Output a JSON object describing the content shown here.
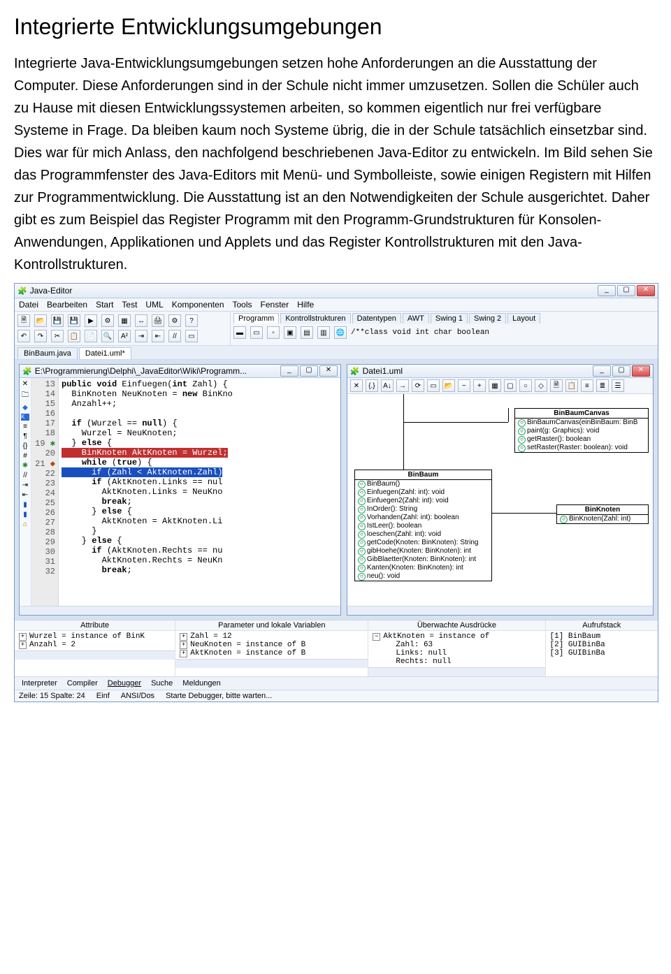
{
  "article": {
    "title": "Integrierte Entwicklungsumgebungen",
    "paragraph": "Integrierte Java-Entwicklungsumgebungen setzen hohe Anforderungen an die Ausstattung der Computer. Diese Anforderungen sind in der Schule nicht immer umzusetzen. Sollen die Schüler auch zu Hause mit diesen Entwicklungssystemen arbeiten, so kommen eigentlich nur frei verfügbare Systeme in Frage. Da bleiben kaum noch Systeme übrig, die in der Schule tatsächlich einsetzbar sind. Dies war für mich Anlass, den nachfolgend beschriebenen Java-Editor zu entwickeln. Im Bild sehen Sie das Programmfenster des Java-Editors mit Menü- und Symbolleiste, sowie einigen Registern mit Hilfen zur Programmentwicklung. Die Ausstattung ist an den Notwendigkeiten der Schule ausgerichtet. Daher gibt es zum Beispiel das Register Programm mit den Programm-Grundstrukturen für Konsolen-Anwendungen, Applikationen und Applets und das Register Kontrollstrukturen mit den Java-Kontrollstrukturen."
  },
  "ide": {
    "app_title": "Java-Editor",
    "menus": [
      "Datei",
      "Bearbeiten",
      "Start",
      "Test",
      "UML",
      "Komponenten",
      "Tools",
      "Fenster",
      "Hilfe"
    ],
    "category_tabs": [
      "Programm",
      "Kontrollstrukturen",
      "Datentypen",
      "AWT",
      "Swing 1",
      "Swing 2",
      "Layout"
    ],
    "template_hint": "/**class void int char boolean",
    "file_tabs": [
      "BinBaum.java",
      "Datei1.uml*"
    ],
    "file_tabs_active": 1,
    "code_window": {
      "title": "E:\\Programmierung\\Delphi\\_JavaEditor\\Wiki\\Programm...",
      "first_line": 13,
      "lines": [
        "public void Einfuegen(int Zahl) {",
        "  BinKnoten NeuKnoten = new BinKno",
        "  Anzahl++;",
        "",
        "  if (Wurzel == null) {",
        "    Wurzel = NeuKnoten;",
        "  } else {",
        "    BinKnoten AktKnoten = Wurzel;",
        "    while (true) {",
        "      if (Zahl < AktKnoten.Zahl)",
        "      if (AktKnoten.Links == nul",
        "        AktKnoten.Links = NeuKno",
        "        break;",
        "      } else {",
        "        AktKnoten = AktKnoten.Li",
        "      }",
        "    } else {",
        "      if (AktKnoten.Rechts == nu",
        "        AktKnoten.Rechts = NeuKn",
        "        break;"
      ],
      "highlight_red_index": 7,
      "highlight_blue_index": 9,
      "breakpoint_index": 7,
      "current_index": 9
    },
    "uml_window": {
      "title": "Datei1.uml",
      "classes": {
        "canvas": {
          "name": "BinBaumCanvas",
          "members": [
            "BinBaumCanvas(einBinBaum: BinB",
            "paint(g: Graphics): void",
            "getRaster(): boolean",
            "setRaster(Raster: boolean): void"
          ]
        },
        "baum": {
          "name": "BinBaum",
          "members": [
            "BinBaum()",
            "Einfuegen(Zahl: int): void",
            "Einfuegen2(Zahl: int): void",
            "InOrder(): String",
            "Vorhanden(Zahl: int): boolean",
            "IstLeer(): boolean",
            "loeschen(Zahl: int): void",
            "getCode(Knoten: BinKnoten): String",
            "gibHoehe(Knoten: BinKnoten): int",
            "GibBlaetter(Knoten: BinKnoten): int",
            "Kanten(Knoten: BinKnoten): int",
            "neu(): void"
          ]
        },
        "knoten": {
          "name": "BinKnoten",
          "members": [
            "BinKnoten(Zahl: int)"
          ]
        }
      }
    },
    "panels": {
      "attribute": {
        "header": "Attribute",
        "rows": [
          "Wurzel = instance of BinK",
          "Anzahl = 2"
        ]
      },
      "params": {
        "header": "Parameter und lokale Variablen",
        "rows": [
          "Zahl = 12",
          "NeuKnoten = instance of B",
          "AktKnoten = instance of B"
        ]
      },
      "watch": {
        "header": "Überwachte Ausdrücke",
        "rows": [
          "AktKnoten = instance of",
          "  Zahl: 63",
          "  Links: null",
          "  Rechts: null"
        ]
      },
      "stack": {
        "header": "Aufrufstack",
        "rows": [
          "[1] BinBaum",
          "[2] GUIBinBa",
          "[3] GUIBinBa"
        ]
      }
    },
    "bottom_tabs": [
      "Interpreter",
      "Compiler",
      "Debugger",
      "Suche",
      "Meldungen"
    ],
    "bottom_tabs_active": 2,
    "status": {
      "pos": "Zeile: 15 Spalte: 24",
      "mode": "Einf",
      "encoding": "ANSI/Dos",
      "msg": "Starte Debugger, bitte warten..."
    }
  }
}
